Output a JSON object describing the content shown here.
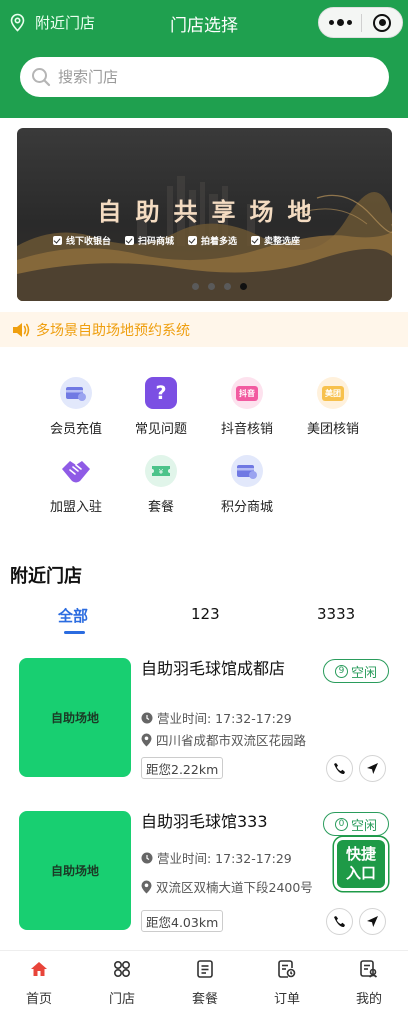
{
  "header": {
    "location_label": "附近门店",
    "title": "门店选择",
    "capsule_more_icon": "more-dots-icon",
    "capsule_close_icon": "target-close-icon"
  },
  "search": {
    "placeholder": "搜索门店"
  },
  "banner": {
    "title": "自助共享场地",
    "tags": [
      "线下收银台",
      "扫码商城",
      "拍着多选",
      "卖整选座"
    ],
    "dot_count": 4,
    "active_dot": 3
  },
  "notice": {
    "text": "多场景自助场地预约系统",
    "icon": "speaker-icon"
  },
  "menu": [
    {
      "label": "会员充值",
      "icon": "card-icon"
    },
    {
      "label": "常见问题",
      "icon": "question-icon"
    },
    {
      "label": "抖音核销",
      "icon": "douyin-icon",
      "icon_text": "抖音"
    },
    {
      "label": "美团核销",
      "icon": "meituan-icon",
      "icon_text": "美团"
    },
    {
      "label": "加盟入驻",
      "icon": "handshake-icon"
    },
    {
      "label": "套餐",
      "icon": "ticket-icon"
    },
    {
      "label": "积分商城",
      "icon": "card-icon"
    }
  ],
  "nearby": {
    "title": "附近门店",
    "tabs": [
      "全部",
      "123",
      "3333"
    ],
    "active_tab": 0
  },
  "stores": [
    {
      "thumb_text": "自助场地",
      "name": "自助羽毛球馆成都店",
      "status_number": "9",
      "status": "空闲",
      "hours": "营业时间: 17:32-17:29",
      "address": "四川省成都市双流区花园路",
      "distance": "距您2.22km"
    },
    {
      "thumb_text": "自助场地",
      "name": "自助羽毛球馆333",
      "status_number": "0",
      "status": "空闲",
      "hours": "营业时间: 17:32-17:29",
      "address": "双流区双楠大道下段2400号",
      "distance": "距您4.03km"
    }
  ],
  "quick_entry": {
    "line1": "快捷",
    "line2": "入口"
  },
  "tabbar": [
    {
      "label": "首页",
      "icon": "home-icon",
      "active": true
    },
    {
      "label": "门店",
      "icon": "grid-icon",
      "active": false
    },
    {
      "label": "套餐",
      "icon": "list-icon",
      "active": false
    },
    {
      "label": "订单",
      "icon": "order-icon",
      "active": false
    },
    {
      "label": "我的",
      "icon": "profile-icon",
      "active": false
    }
  ],
  "colors": {
    "brand_green": "#1fa04f",
    "status_green": "#2a9c5c",
    "thumb_green": "#18cf71",
    "notice_orange": "#ef9f0f",
    "tab_blue": "#2b6ce0",
    "home_red": "#e8443a"
  }
}
